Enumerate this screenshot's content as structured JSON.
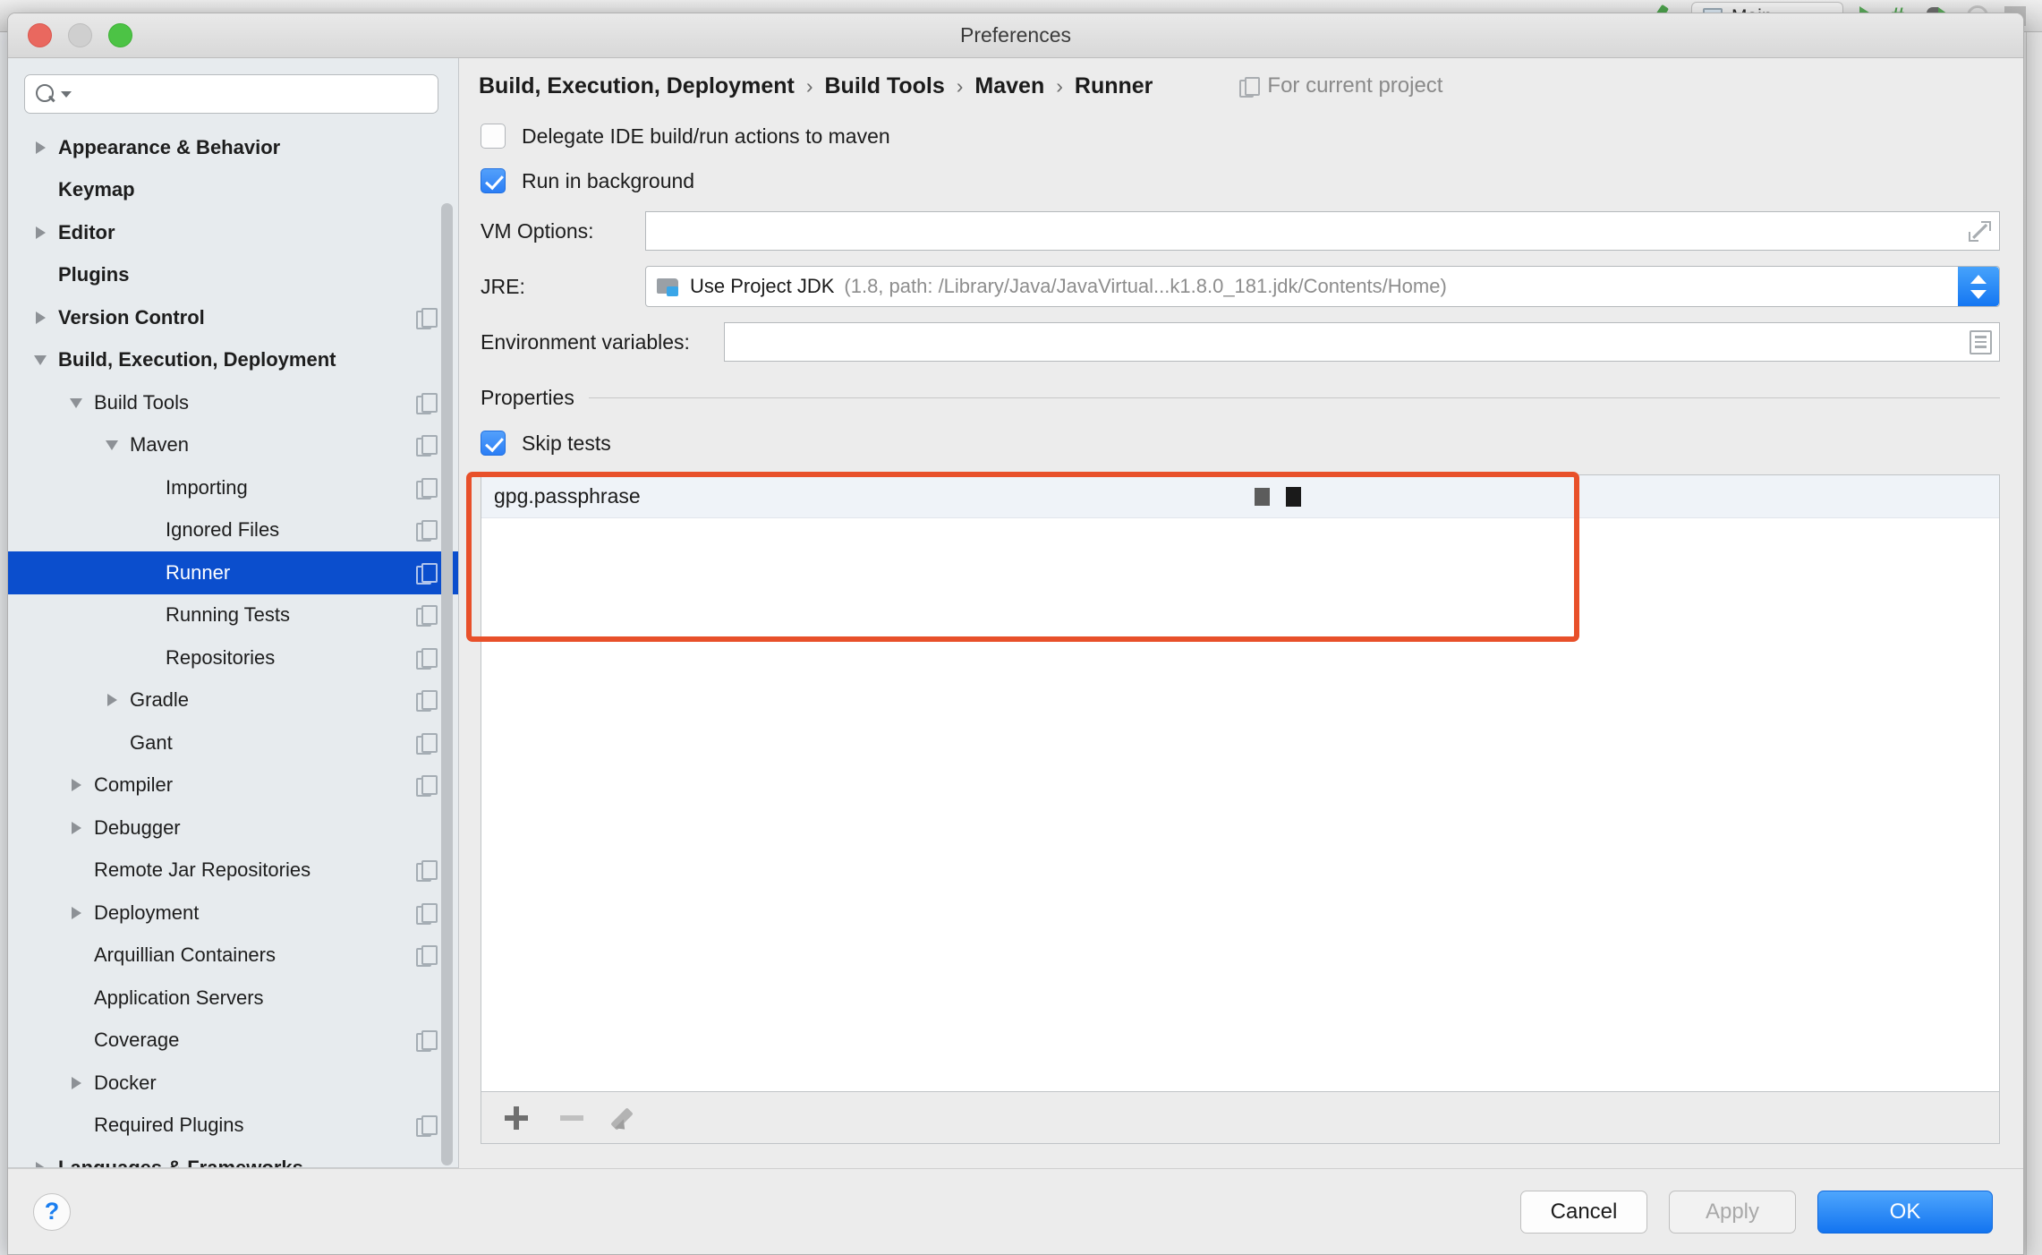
{
  "ide": {
    "run_config": "Main",
    "icons": [
      "wrench-icon",
      "run-config-icon",
      "run-icon",
      "debug-icon",
      "debug-run-icon",
      "coverage-icon",
      "stop-icon"
    ]
  },
  "window": {
    "title": "Preferences",
    "traffic_lights": [
      "close",
      "minimize",
      "maximize"
    ]
  },
  "search": {
    "value": "",
    "placeholder": ""
  },
  "sidebar": {
    "items": [
      {
        "label": "Appearance & Behavior",
        "level": 0,
        "arrow": "right",
        "bold": true,
        "copy": false,
        "selected": false
      },
      {
        "label": "Keymap",
        "level": 0,
        "arrow": "none",
        "bold": true,
        "copy": false,
        "selected": false
      },
      {
        "label": "Editor",
        "level": 0,
        "arrow": "right",
        "bold": true,
        "copy": false,
        "selected": false
      },
      {
        "label": "Plugins",
        "level": 0,
        "arrow": "none",
        "bold": true,
        "copy": false,
        "selected": false
      },
      {
        "label": "Version Control",
        "level": 0,
        "arrow": "right",
        "bold": true,
        "copy": true,
        "selected": false
      },
      {
        "label": "Build, Execution, Deployment",
        "level": 0,
        "arrow": "down",
        "bold": true,
        "copy": false,
        "selected": false
      },
      {
        "label": "Build Tools",
        "level": 1,
        "arrow": "down",
        "bold": false,
        "copy": true,
        "selected": false
      },
      {
        "label": "Maven",
        "level": 2,
        "arrow": "down",
        "bold": false,
        "copy": true,
        "selected": false
      },
      {
        "label": "Importing",
        "level": 3,
        "arrow": "none",
        "bold": false,
        "copy": true,
        "selected": false
      },
      {
        "label": "Ignored Files",
        "level": 3,
        "arrow": "none",
        "bold": false,
        "copy": true,
        "selected": false
      },
      {
        "label": "Runner",
        "level": 3,
        "arrow": "none",
        "bold": false,
        "copy": true,
        "selected": true
      },
      {
        "label": "Running Tests",
        "level": 3,
        "arrow": "none",
        "bold": false,
        "copy": true,
        "selected": false
      },
      {
        "label": "Repositories",
        "level": 3,
        "arrow": "none",
        "bold": false,
        "copy": true,
        "selected": false
      },
      {
        "label": "Gradle",
        "level": 2,
        "arrow": "right",
        "bold": false,
        "copy": true,
        "selected": false
      },
      {
        "label": "Gant",
        "level": 2,
        "arrow": "none",
        "bold": false,
        "copy": true,
        "selected": false
      },
      {
        "label": "Compiler",
        "level": 1,
        "arrow": "right",
        "bold": false,
        "copy": true,
        "selected": false
      },
      {
        "label": "Debugger",
        "level": 1,
        "arrow": "right",
        "bold": false,
        "copy": false,
        "selected": false
      },
      {
        "label": "Remote Jar Repositories",
        "level": 1,
        "arrow": "none",
        "bold": false,
        "copy": true,
        "selected": false
      },
      {
        "label": "Deployment",
        "level": 1,
        "arrow": "right",
        "bold": false,
        "copy": true,
        "selected": false
      },
      {
        "label": "Arquillian Containers",
        "level": 1,
        "arrow": "none",
        "bold": false,
        "copy": true,
        "selected": false
      },
      {
        "label": "Application Servers",
        "level": 1,
        "arrow": "none",
        "bold": false,
        "copy": false,
        "selected": false
      },
      {
        "label": "Coverage",
        "level": 1,
        "arrow": "none",
        "bold": false,
        "copy": true,
        "selected": false
      },
      {
        "label": "Docker",
        "level": 1,
        "arrow": "right",
        "bold": false,
        "copy": false,
        "selected": false
      },
      {
        "label": "Required Plugins",
        "level": 1,
        "arrow": "none",
        "bold": false,
        "copy": true,
        "selected": false
      },
      {
        "label": "Languages & Frameworks",
        "level": 0,
        "arrow": "right",
        "bold": true,
        "copy": false,
        "selected": false
      }
    ]
  },
  "breadcrumb": {
    "crumbs": [
      "Build, Execution, Deployment",
      "Build Tools",
      "Maven",
      "Runner"
    ],
    "separator": "›",
    "scope_label": "For current project"
  },
  "form": {
    "delegate": {
      "label": "Delegate IDE build/run actions to maven",
      "checked": false
    },
    "run_in_background": {
      "label": "Run in background",
      "checked": true
    },
    "vm_options": {
      "label": "VM Options:",
      "value": "",
      "placeholder": ""
    },
    "jre": {
      "label": "JRE:",
      "main": "Use Project JDK",
      "detail": "(1.8, path: /Library/Java/JavaVirtual...k1.8.0_181.jdk/Contents/Home)"
    },
    "env": {
      "label": "Environment variables:",
      "value": "",
      "placeholder": ""
    }
  },
  "properties": {
    "title": "Properties",
    "skip_tests": {
      "label": "Skip tests",
      "checked": true
    },
    "rows": [
      {
        "key": "gpg.passphrase",
        "value_masked": true
      }
    ],
    "toolbar": {
      "add_label": "+",
      "remove_label": "−",
      "edit_label": "edit"
    }
  },
  "footer": {
    "help_label": "?",
    "cancel_label": "Cancel",
    "apply_label": "Apply",
    "apply_enabled": false,
    "ok_label": "OK"
  },
  "colors": {
    "selection_blue": "#0b4ecd",
    "primary_button": "#1374f0",
    "highlight_orange": "#e8502a",
    "sidebar_bg": "#e7ebee"
  }
}
